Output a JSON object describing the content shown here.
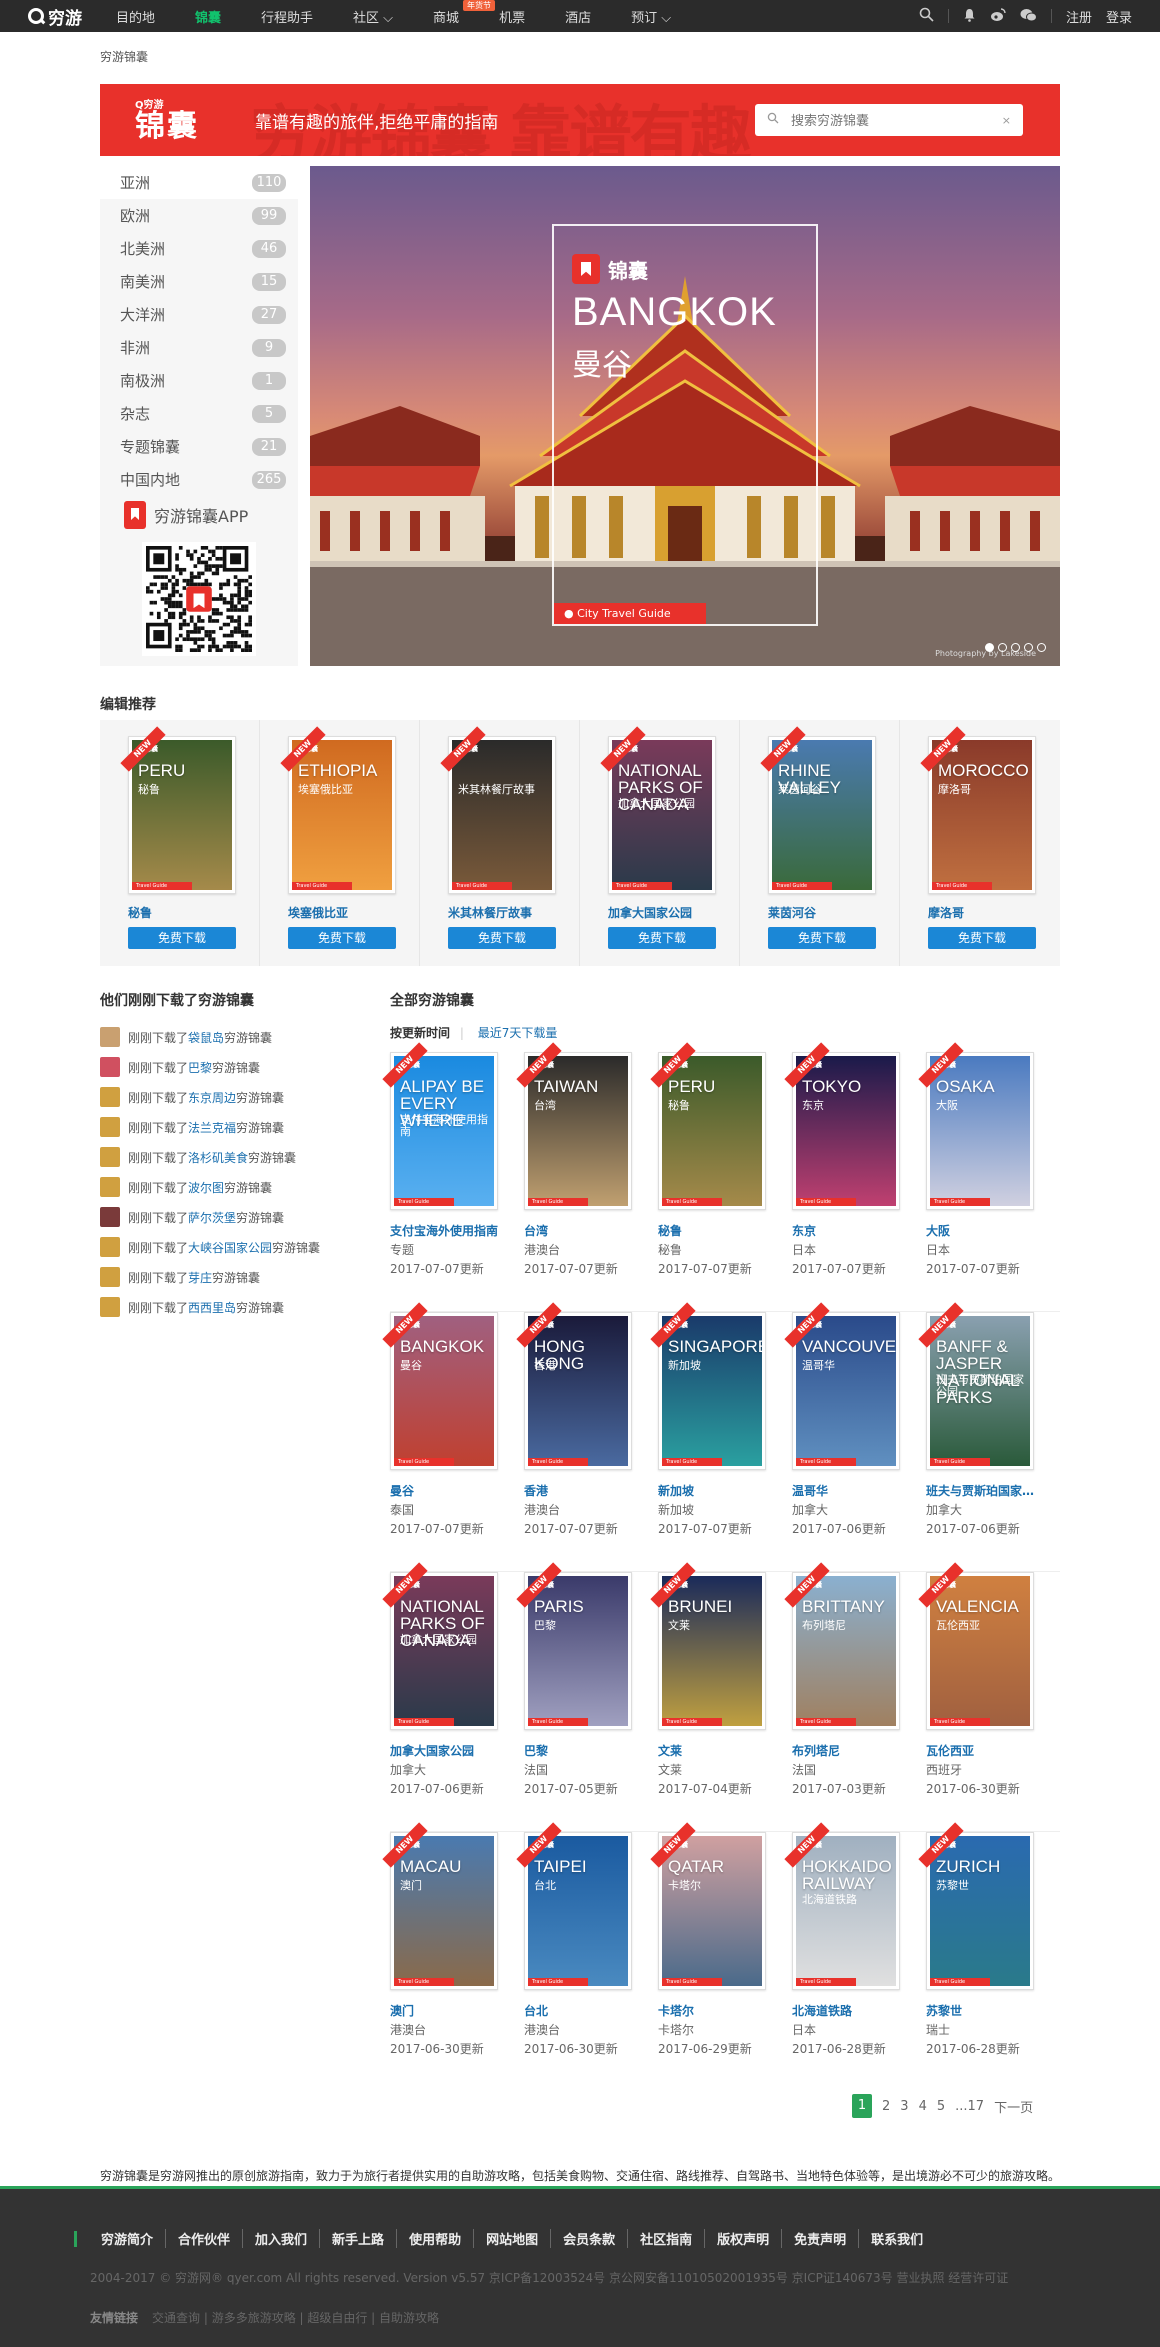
{
  "nav": {
    "logo": "穷游",
    "items": [
      {
        "label": "目的地",
        "active": false
      },
      {
        "label": "锦囊",
        "active": true
      },
      {
        "label": "行程助手",
        "active": false
      },
      {
        "label": "社区 ⌵",
        "active": false
      },
      {
        "label": "商城",
        "active": false,
        "badge": "年货节"
      },
      {
        "label": "机票",
        "active": false
      },
      {
        "label": "酒店",
        "active": false
      },
      {
        "label": "预订 ⌵",
        "active": false
      }
    ],
    "register": "注册",
    "login": "登录"
  },
  "breadcrumb": "穷游锦囊",
  "banner": {
    "logo_small": "Q穷游",
    "logo_big": "锦囊",
    "slogan": "靠谱有趣的旅伴,拒绝平庸的指南",
    "search_placeholder": "搜索穷游锦囊"
  },
  "sidebar": {
    "categories": [
      {
        "label": "亚洲",
        "count": "110"
      },
      {
        "label": "欧洲",
        "count": "99"
      },
      {
        "label": "北美洲",
        "count": "46"
      },
      {
        "label": "南美洲",
        "count": "15"
      },
      {
        "label": "大洋洲",
        "count": "27"
      },
      {
        "label": "非洲",
        "count": "9"
      },
      {
        "label": "南极洲",
        "count": "1"
      },
      {
        "label": "杂志",
        "count": "5"
      },
      {
        "label": "专题锦囊",
        "count": "21"
      },
      {
        "label": "中国内地",
        "count": "265"
      }
    ],
    "app_label": "穷游锦囊APP"
  },
  "hero": {
    "logo": "锦囊",
    "city_en": "BANGKOK",
    "city_cn": "曼谷",
    "tag": "City Travel Guide",
    "photo_credit": "Photography by Lakeside"
  },
  "picks": {
    "heading": "编辑推荐",
    "button_label": "免费下载",
    "items": [
      {
        "title": "秘鲁",
        "en": "PERU",
        "cn": "秘鲁",
        "c1": "#3b5a2a",
        "c2": "#a58a4a"
      },
      {
        "title": "埃塞俄比亚",
        "en": "ETHIOPIA",
        "cn": "埃塞俄比亚",
        "c1": "#d06a20",
        "c2": "#f0a040"
      },
      {
        "title": "米其林餐厅故事",
        "en": "",
        "cn": "米其林餐厅故事",
        "c1": "#2a2a2a",
        "c2": "#7a5a3a"
      },
      {
        "title": "加拿大国家公园",
        "en": "NATIONAL PARKS OF CANADA",
        "cn": "加拿大国家公园",
        "c1": "#7a3a5a",
        "c2": "#2a3a4a"
      },
      {
        "title": "莱茵河谷",
        "en": "RHINE VALLEY",
        "cn": "莱茵河谷",
        "c1": "#4a7ab0",
        "c2": "#3a6a3a"
      },
      {
        "title": "摩洛哥",
        "en": "MOROCCO",
        "cn": "摩洛哥",
        "c1": "#8a3a2a",
        "c2": "#c07040"
      }
    ]
  },
  "recent": {
    "heading": "他们刚刚下载了穷游锦囊",
    "prefix": "刚刚下载了",
    "suffix": "穷游锦囊",
    "items": [
      {
        "place": "袋鼠岛",
        "color": "#c9a070"
      },
      {
        "place": "巴黎",
        "color": "#d05060"
      },
      {
        "place": "东京周边",
        "color": "#d0a040"
      },
      {
        "place": "法兰克福",
        "color": "#d0a040"
      },
      {
        "place": "洛杉矶美食",
        "color": "#d0a040"
      },
      {
        "place": "波尔图",
        "color": "#d0a040"
      },
      {
        "place": "萨尔茨堡",
        "color": "#7a3a3a"
      },
      {
        "place": "大峡谷国家公园",
        "color": "#d0a040"
      },
      {
        "place": "芽庄",
        "color": "#d0a040"
      },
      {
        "place": "西西里岛",
        "color": "#d0a040"
      }
    ]
  },
  "all": {
    "heading": "全部穷游锦囊",
    "sort_active": "按更新时间",
    "sort_other": "最近7天下载量",
    "rows": [
      [
        {
          "name": "支付宝海外使用指南",
          "sub": "专题",
          "date": "2017-07-07更新",
          "en": "ALIPAY BE EVERY WHERE",
          "cn": "支付宝海外使用指南",
          "c1": "#1a8ae0",
          "c2": "#5ab0f0"
        },
        {
          "name": "台湾",
          "sub": "港澳台",
          "date": "2017-07-07更新",
          "en": "TAIWAN",
          "cn": "台湾",
          "c1": "#2a2a2a",
          "c2": "#c0a070"
        },
        {
          "name": "秘鲁",
          "sub": "秘鲁",
          "date": "2017-07-07更新",
          "en": "PERU",
          "cn": "秘鲁",
          "c1": "#3b5a2a",
          "c2": "#a58a4a"
        },
        {
          "name": "东京",
          "sub": "日本",
          "date": "2017-07-07更新",
          "en": "TOKYO",
          "cn": "东京",
          "c1": "#1a1a4a",
          "c2": "#c04070"
        },
        {
          "name": "大阪",
          "sub": "日本",
          "date": "2017-07-07更新",
          "en": "OSAKA",
          "cn": "大阪",
          "c1": "#4a7ac0",
          "c2": "#d0d0e0"
        }
      ],
      [
        {
          "name": "曼谷",
          "sub": "泰国",
          "date": "2017-07-07更新",
          "en": "BANGKOK",
          "cn": "曼谷",
          "c1": "#a06080",
          "c2": "#c04030"
        },
        {
          "name": "香港",
          "sub": "港澳台",
          "date": "2017-07-07更新",
          "en": "HONG KONG",
          "cn": "香港",
          "c1": "#1a1a3a",
          "c2": "#4a6aa0"
        },
        {
          "name": "新加坡",
          "sub": "新加坡",
          "date": "2017-07-07更新",
          "en": "SINGAPORE",
          "cn": "新加坡",
          "c1": "#1a3a6a",
          "c2": "#2aa0a0"
        },
        {
          "name": "温哥华",
          "sub": "加拿大",
          "date": "2017-07-06更新",
          "en": "VANCOUVER",
          "cn": "温哥华",
          "c1": "#2a4a8a",
          "c2": "#6090c0"
        },
        {
          "name": "班夫与贾斯珀国家公园",
          "sub": "加拿大",
          "date": "2017-07-06更新",
          "en": "BANFF & JASPER NATIONAL PARKS",
          "cn": "班夫与贾斯珀国家公园",
          "c1": "#8aa0b0",
          "c2": "#2a5a3a"
        }
      ],
      [
        {
          "name": "加拿大国家公园",
          "sub": "加拿大",
          "date": "2017-07-06更新",
          "en": "NATIONAL PARKS OF CANADA",
          "cn": "加拿大国家公园",
          "c1": "#7a3a5a",
          "c2": "#2a3a4a"
        },
        {
          "name": "巴黎",
          "sub": "法国",
          "date": "2017-07-05更新",
          "en": "PARIS",
          "cn": "巴黎",
          "c1": "#3a3a6a",
          "c2": "#a0a0c0"
        },
        {
          "name": "文莱",
          "sub": "文莱",
          "date": "2017-07-04更新",
          "en": "BRUNEI",
          "cn": "文莱",
          "c1": "#1a2a5a",
          "c2": "#c0a040"
        },
        {
          "name": "布列塔尼",
          "sub": "法国",
          "date": "2017-07-03更新",
          "en": "BRITTANY",
          "cn": "布列塔尼",
          "c1": "#8ab0d0",
          "c2": "#a08060"
        },
        {
          "name": "瓦伦西亚",
          "sub": "西班牙",
          "date": "2017-06-30更新",
          "en": "VALENCIA",
          "cn": "瓦伦西亚",
          "c1": "#d08040",
          "c2": "#a06040"
        }
      ],
      [
        {
          "name": "澳门",
          "sub": "港澳台",
          "date": "2017-06-30更新",
          "en": "MACAU",
          "cn": "澳门",
          "c1": "#4a7ab0",
          "c2": "#8a6a4a"
        },
        {
          "name": "台北",
          "sub": "港澳台",
          "date": "2017-06-30更新",
          "en": "TAIPEI",
          "cn": "台北",
          "c1": "#1a5aa0",
          "c2": "#4a8ac0"
        },
        {
          "name": "卡塔尔",
          "sub": "卡塔尔",
          "date": "2017-06-29更新",
          "en": "QATAR",
          "cn": "卡塔尔",
          "c1": "#d0a0a0",
          "c2": "#4a6a8a"
        },
        {
          "name": "北海道铁路",
          "sub": "日本",
          "date": "2017-06-28更新",
          "en": "HOKKAIDO RAILWAY",
          "cn": "北海道铁路",
          "c1": "#a0b0c0",
          "c2": "#e0e0e0"
        },
        {
          "name": "苏黎世",
          "sub": "瑞士",
          "date": "2017-06-28更新",
          "en": "ZURICH",
          "cn": "苏黎世",
          "c1": "#2a6ab0",
          "c2": "#2a7a8a"
        }
      ]
    ]
  },
  "pager": {
    "current": "1",
    "pages": [
      "2",
      "3",
      "4",
      "5"
    ],
    "last": "...17",
    "next": "下一页"
  },
  "description": "穷游锦囊是穷游网推出的原创旅游指南，致力于为旅行者提供实用的自助游攻略，包括美食购物、交通住宿、路线推荐、自驾路书、当地特色体验等，是出境游必不可少的旅游攻略。",
  "footer": {
    "links": [
      "穷游简介",
      "合作伙伴",
      "加入我们",
      "新手上路",
      "使用帮助",
      "网站地图",
      "会员条款",
      "社区指南",
      "版权声明",
      "免责声明",
      "联系我们"
    ],
    "copyright": "2004-2017 © 穷游网® qyer.com All rights reserved. Version v5.57 京ICP备12003524号 京公网安备11010502001935号 京ICP证140673号 营业执照 经营许可证",
    "friend_label": "友情链接",
    "friend_links": "交通查询 | 游多多旅游攻略 | 超级自由行 | 自助游攻略"
  },
  "colors": {
    "brand_red": "#e8312b",
    "accent_green": "#2aa45a",
    "link_blue": "#1b6fae",
    "button_blue": "#1b87d6"
  }
}
